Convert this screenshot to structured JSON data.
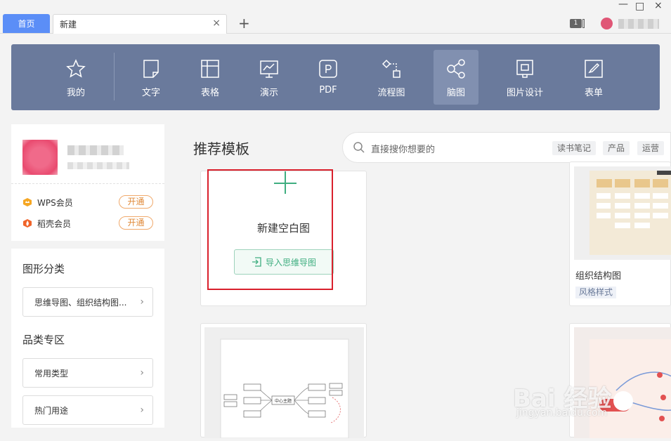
{
  "tabs": {
    "home": "首页",
    "new_doc": "新建",
    "close": "×",
    "add": "+"
  },
  "window": {
    "min": "—",
    "max": "□",
    "close": "×",
    "badge": "1"
  },
  "nav": {
    "items": [
      {
        "label": "我的",
        "icon": "star-icon"
      },
      {
        "label": "文字",
        "icon": "document-icon"
      },
      {
        "label": "表格",
        "icon": "table-icon"
      },
      {
        "label": "演示",
        "icon": "presentation-icon"
      },
      {
        "label": "PDF",
        "icon": "pdf-icon"
      },
      {
        "label": "流程图",
        "icon": "flowchart-icon"
      },
      {
        "label": "脑图",
        "icon": "mindmap-icon",
        "active": true
      },
      {
        "label": "图片设计",
        "icon": "image-design-icon"
      },
      {
        "label": "表单",
        "icon": "form-icon"
      }
    ]
  },
  "sidebar": {
    "members": [
      {
        "label": "WPS会员",
        "button": "开通",
        "icon": "crown-icon",
        "color": "#f5a623"
      },
      {
        "label": "稻壳会员",
        "button": "开通",
        "icon": "flame-icon",
        "color": "#f0642a"
      }
    ],
    "section1_title": "图形分类",
    "section1_select": "思维导图、组织结构图...",
    "section2_title": "品类专区",
    "section2_items": [
      "常用类型",
      "热门用途"
    ]
  },
  "main": {
    "title": "推荐模板",
    "search_placeholder": "直接搜你想要的",
    "chips": [
      "读书笔记",
      "产品",
      "运营"
    ],
    "new_blank": "新建空白图",
    "import_button": "导入思维导图",
    "org_card_title": "组织结构图",
    "org_card_tag": "风格样式",
    "mindmap_center": "中心主题"
  },
  "watermark": {
    "main": "Bai 经验",
    "sub": "jingyan.baidu.com"
  },
  "colors": {
    "accent_blue": "#5b8ef7",
    "nav_bg": "#6a7a9c",
    "green": "#3fae80",
    "highlight_red": "#d9202c"
  }
}
